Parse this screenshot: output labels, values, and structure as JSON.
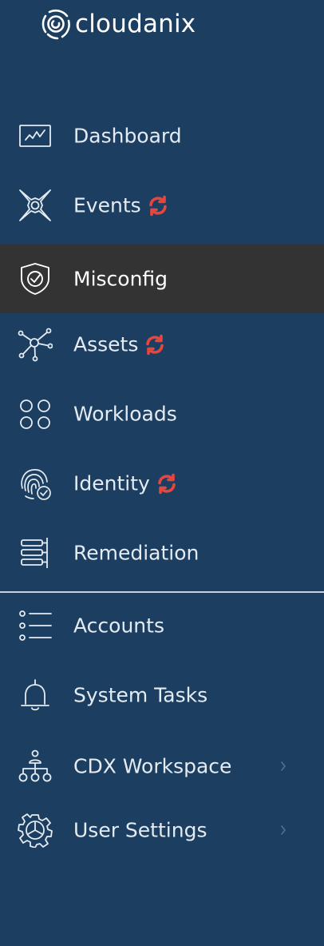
{
  "brand": {
    "name": "cloudanix"
  },
  "nav": {
    "primary": [
      {
        "id": "dashboard",
        "label": "Dashboard",
        "icon": "dashboard-chart-icon",
        "sync": false,
        "active": false
      },
      {
        "id": "events",
        "label": "Events",
        "icon": "events-shuriken-icon",
        "sync": true,
        "active": false
      },
      {
        "id": "misconfig",
        "label": "Misconfig",
        "icon": "shield-check-icon",
        "sync": false,
        "active": true
      },
      {
        "id": "assets",
        "label": "Assets",
        "icon": "network-nodes-icon",
        "sync": true,
        "active": false
      },
      {
        "id": "workloads",
        "label": "Workloads",
        "icon": "four-circles-icon",
        "sync": false,
        "active": false
      },
      {
        "id": "identity",
        "label": "Identity",
        "icon": "fingerprint-check-icon",
        "sync": true,
        "active": false
      },
      {
        "id": "remediation",
        "label": "Remediation",
        "icon": "stacked-bars-icon",
        "sync": false,
        "active": false
      }
    ],
    "secondary": [
      {
        "id": "accounts",
        "label": "Accounts",
        "icon": "list-icon",
        "expandable": false
      },
      {
        "id": "system-tasks",
        "label": "System Tasks",
        "icon": "bell-icon",
        "expandable": false
      },
      {
        "id": "cdx-workspace",
        "label": "CDX Workspace",
        "icon": "org-tree-icon",
        "expandable": true
      },
      {
        "id": "user-settings",
        "label": "User Settings",
        "icon": "gear-icon",
        "expandable": true
      }
    ]
  },
  "colors": {
    "background": "#1c3e61",
    "active_background": "#333333",
    "text": "#e4ebf2",
    "sync_icon": "#e8453c",
    "divider": "#c8d2dc"
  }
}
